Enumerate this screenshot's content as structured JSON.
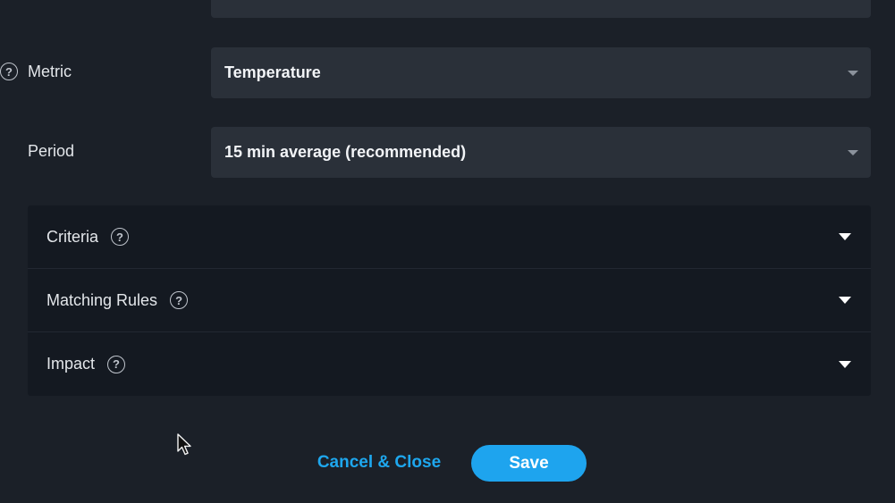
{
  "form": {
    "metric": {
      "label": "Metric",
      "value": "Temperature",
      "help_icon": "question-circle-icon"
    },
    "period": {
      "label": "Period",
      "value": "15 min average (recommended)"
    }
  },
  "sections": [
    {
      "label": "Criteria",
      "help_icon": "question-circle-icon",
      "expand_icon": "caret-down-icon"
    },
    {
      "label": "Matching Rules",
      "help_icon": "question-circle-icon",
      "expand_icon": "caret-down-icon"
    },
    {
      "label": "Impact",
      "help_icon": "question-circle-icon",
      "expand_icon": "caret-down-icon"
    }
  ],
  "help_glyph": "?",
  "actions": {
    "cancel_label": "Cancel & Close",
    "save_label": "Save"
  },
  "colors": {
    "background": "#1b2028",
    "select_bg": "#2a3039",
    "accordion_bg": "#141921",
    "accent": "#1ea4ee"
  }
}
